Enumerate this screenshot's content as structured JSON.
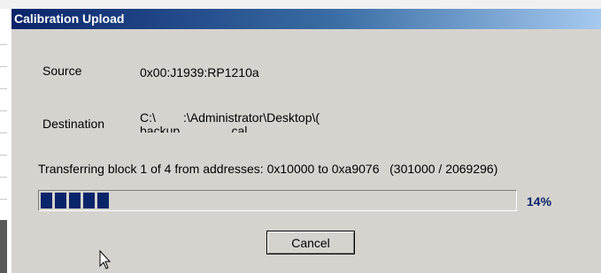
{
  "dialog": {
    "title": "Calibration Upload",
    "source_label": "Source",
    "source_value": "0x00:J1939:RP1210a",
    "destination_label": "Destination",
    "destination_value": "C:\\        :\\Administrator\\Desktop\\(\nbackup               cal",
    "status_text": "Transferring block 1 of 4 from addresses: 0x10000 to 0xa9076   (301000 / 2069296)",
    "progress": 0.14,
    "percent_text": "14%",
    "cancel_label": "Cancel",
    "accent_color": "#0a246a"
  }
}
